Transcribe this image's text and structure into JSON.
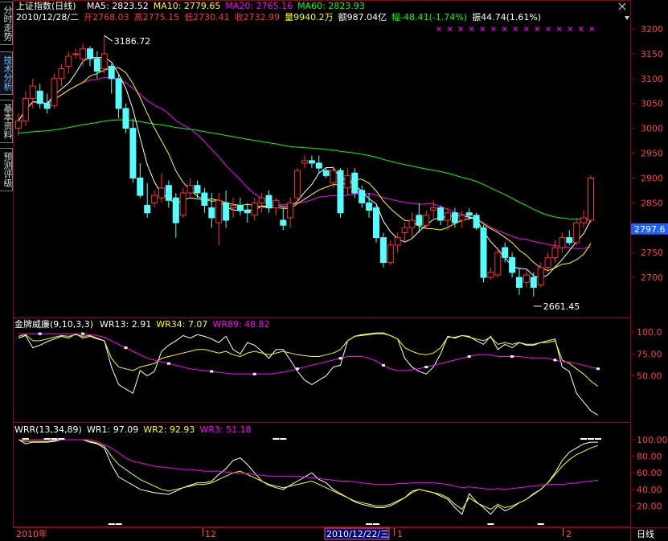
{
  "tabs": [
    {
      "label": "分时走势"
    },
    {
      "label": "技术分析"
    },
    {
      "label": "基本资料"
    },
    {
      "label": "预测评级"
    }
  ],
  "main_header": {
    "title": "上证指数(日线)",
    "ma": [
      {
        "label": "MA5: 2823.52",
        "color": "#ffffff"
      },
      {
        "label": "MA10: 2779.65",
        "color": "#ffff00"
      },
      {
        "label": "MA20: 2765.16",
        "color": "#ff00ff"
      },
      {
        "label": "MA60: 2823.93",
        "color": "#00ff00"
      }
    ]
  },
  "info_line": [
    {
      "text": "2010/12/28/二",
      "color": "#ffffff"
    },
    {
      "text": "开2768.03",
      "color": "#ff3333"
    },
    {
      "text": "高2775.15",
      "color": "#ff3333"
    },
    {
      "text": "低2730.41",
      "color": "#ff3333"
    },
    {
      "text": "收2732.99",
      "color": "#ff3333"
    },
    {
      "text": "量9940.2万",
      "color": "#ffff00"
    },
    {
      "text": "额987.04亿",
      "color": "#ffffff"
    },
    {
      "text": "幅-48.41(-1.74%)",
      "color": "#00ff00"
    },
    {
      "text": "振44.74(1.61%)",
      "color": "#ffffff"
    }
  ],
  "price_axis": {
    "ticks": [
      "3200",
      "3150",
      "3100",
      "3050",
      "3000",
      "2950",
      "2900",
      "2850",
      "2800",
      "2750",
      "2700"
    ],
    "current_label": "2797.6"
  },
  "annotations": {
    "high": "3186.72",
    "low": "2661.45"
  },
  "wr_panel": {
    "title": "金牌威廉(9,10,3,3)",
    "items": [
      {
        "label": "WR13: 2.91",
        "color": "#ffffff"
      },
      {
        "label": "WR34: 7.07",
        "color": "#ffff00"
      },
      {
        "label": "WR89: 48.82",
        "color": "#ff00ff"
      }
    ],
    "ticks": [
      "100.0",
      "75.00",
      "50.00"
    ]
  },
  "wrr_panel": {
    "title": "WRR(13,34,89)",
    "items": [
      {
        "label": "WR1: 97.09",
        "color": "#ffffff"
      },
      {
        "label": "WR2: 92.93",
        "color": "#ffff00"
      },
      {
        "label": "WR3: 51.18",
        "color": "#ff00ff"
      }
    ],
    "ticks": [
      "100.00",
      "80.00",
      "60.00",
      "40.00",
      "20.00"
    ]
  },
  "time_axis": {
    "labels": [
      "2010年",
      "12",
      "2010/12/22/三",
      "1",
      "2"
    ],
    "period": "日线"
  },
  "colors": {
    "up": "#ff3030",
    "down": "#54ffff",
    "ma5": "#ffffff",
    "ma10": "#ffff00",
    "ma20": "#ff00ff",
    "ma60": "#00ff00",
    "frame": "#a00000"
  },
  "chart_data": {
    "type": "candlestick",
    "candles": [
      [
        3000,
        3030,
        2985,
        3015
      ],
      [
        3015,
        3075,
        3005,
        3060
      ],
      [
        3060,
        3100,
        3040,
        3085
      ],
      [
        3075,
        3090,
        3040,
        3050
      ],
      [
        3050,
        3070,
        3030,
        3040
      ],
      [
        3045,
        3110,
        3040,
        3100
      ],
      [
        3100,
        3130,
        3085,
        3120
      ],
      [
        3125,
        3155,
        3110,
        3145
      ],
      [
        3150,
        3160,
        3140,
        3150
      ],
      [
        3140,
        3170,
        3125,
        3160
      ],
      [
        3160,
        3165,
        3125,
        3140
      ],
      [
        3140,
        3155,
        3100,
        3115
      ],
      [
        3120,
        3186.72,
        3110,
        3150
      ],
      [
        3125,
        3130,
        3070,
        3100
      ],
      [
        3100,
        3110,
        3020,
        3040
      ],
      [
        3040,
        3050,
        2990,
        3000
      ],
      [
        3000,
        3020,
        2890,
        2900
      ],
      [
        2900,
        2930,
        2860,
        2865
      ],
      [
        2845,
        2890,
        2820,
        2830
      ],
      [
        2850,
        2875,
        2840,
        2865
      ],
      [
        2860,
        2910,
        2850,
        2880
      ],
      [
        2885,
        2895,
        2840,
        2855
      ],
      [
        2860,
        2870,
        2780,
        2810
      ],
      [
        2825,
        2880,
        2820,
        2870
      ],
      [
        2870,
        2900,
        2860,
        2885
      ],
      [
        2885,
        2895,
        2860,
        2870
      ],
      [
        2870,
        2880,
        2830,
        2845
      ],
      [
        2840,
        2870,
        2800,
        2820
      ],
      [
        2810,
        2870,
        2765,
        2855
      ],
      [
        2850,
        2875,
        2800,
        2815
      ],
      [
        2840,
        2860,
        2820,
        2845
      ],
      [
        2845,
        2860,
        2825,
        2835
      ],
      [
        2835,
        2850,
        2810,
        2830
      ],
      [
        2825,
        2860,
        2815,
        2850
      ],
      [
        2850,
        2870,
        2830,
        2860
      ],
      [
        2865,
        2875,
        2830,
        2840
      ],
      [
        2840,
        2860,
        2825,
        2855
      ],
      [
        2815,
        2840,
        2795,
        2805
      ],
      [
        2820,
        2860,
        2800,
        2850
      ],
      [
        2860,
        2920,
        2850,
        2915
      ],
      [
        2930,
        2945,
        2920,
        2935
      ],
      [
        2935,
        2945,
        2920,
        2930
      ],
      [
        2930,
        2945,
        2910,
        2920
      ],
      [
        2915,
        2920,
        2900,
        2905
      ],
      [
        2890,
        2925,
        2880,
        2915
      ],
      [
        2915,
        2920,
        2820,
        2830
      ],
      [
        2880,
        2920,
        2865,
        2905
      ],
      [
        2910,
        2920,
        2860,
        2870
      ],
      [
        2875,
        2885,
        2840,
        2850
      ],
      [
        2850,
        2870,
        2820,
        2835
      ],
      [
        2840,
        2845,
        2770,
        2780
      ],
      [
        2780,
        2790,
        2720,
        2730
      ],
      [
        2730,
        2775.15,
        2725,
        2765
      ],
      [
        2765,
        2790,
        2750,
        2780
      ],
      [
        2790,
        2810,
        2770,
        2800
      ],
      [
        2800,
        2830,
        2780,
        2815
      ],
      [
        2825,
        2850,
        2790,
        2805
      ],
      [
        2805,
        2835,
        2800,
        2825
      ],
      [
        2835,
        2855,
        2820,
        2840
      ],
      [
        2840,
        2845,
        2805,
        2815
      ],
      [
        2815,
        2840,
        2795,
        2830
      ],
      [
        2830,
        2840,
        2800,
        2810
      ],
      [
        2815,
        2835,
        2800,
        2825
      ],
      [
        2830,
        2840,
        2815,
        2825
      ],
      [
        2825,
        2830,
        2795,
        2800
      ],
      [
        2800,
        2805,
        2690,
        2700
      ],
      [
        2700,
        2720,
        2695,
        2710
      ],
      [
        2705,
        2760,
        2700,
        2750
      ],
      [
        2760,
        2770,
        2730,
        2740
      ],
      [
        2740,
        2750,
        2700,
        2710
      ],
      [
        2700,
        2720,
        2665,
        2680
      ],
      [
        2690,
        2715,
        2680,
        2705
      ],
      [
        2700,
        2710,
        2661.45,
        2680
      ],
      [
        2685,
        2730,
        2680,
        2720
      ],
      [
        2720,
        2750,
        2710,
        2740
      ],
      [
        2740,
        2775,
        2730,
        2760
      ],
      [
        2760,
        2790,
        2750,
        2780
      ],
      [
        2780,
        2795,
        2765,
        2770
      ],
      [
        2770,
        2820,
        2765,
        2810
      ],
      [
        2810,
        2835,
        2800,
        2820
      ],
      [
        2815,
        2905,
        2810,
        2900
      ]
    ],
    "wr_panel": {
      "wr13": [
        93,
        96,
        82,
        85,
        89,
        92,
        95,
        93,
        98,
        93,
        95,
        92,
        90,
        60,
        40,
        35,
        30,
        56,
        50,
        55,
        78,
        85,
        90,
        96,
        93,
        97,
        95,
        92,
        88,
        95,
        80,
        75,
        88,
        85,
        78,
        70,
        80,
        80,
        68,
        55,
        45,
        40,
        45,
        50,
        60,
        62,
        90,
        95,
        97,
        98,
        99,
        99,
        96,
        92,
        70,
        60,
        55,
        52,
        60,
        75,
        95,
        93,
        96,
        95,
        90,
        86,
        95,
        80,
        86,
        82,
        88,
        85,
        85,
        88,
        90,
        92,
        60,
        55,
        30,
        20,
        10,
        5
      ],
      "wr34": [
        95,
        97,
        90,
        90,
        92,
        94,
        96,
        95,
        97,
        95,
        96,
        93,
        90,
        70,
        60,
        58,
        56,
        60,
        62,
        64,
        70,
        72,
        74,
        76,
        78,
        80,
        80,
        78,
        76,
        78,
        74,
        72,
        76,
        78,
        76,
        74,
        76,
        78,
        76,
        74,
        73,
        72,
        72,
        74,
        76,
        80,
        90,
        95,
        96,
        97,
        98,
        98,
        96,
        92,
        82,
        78,
        75,
        74,
        76,
        82,
        94,
        94,
        96,
        94,
        92,
        90,
        94,
        86,
        88,
        86,
        88,
        86,
        86,
        88,
        88,
        90,
        68,
        64,
        58,
        52,
        44,
        38
      ],
      "wr89": [
        98,
        98,
        98,
        98,
        98,
        98,
        98,
        98,
        98,
        98,
        97,
        96,
        94,
        90,
        86,
        82,
        78,
        74,
        70,
        68,
        66,
        64,
        62,
        60,
        58,
        57,
        56,
        55,
        54,
        53,
        52,
        52,
        52,
        52,
        52,
        52,
        53,
        54,
        56,
        58,
        60,
        62,
        64,
        66,
        68,
        70,
        72,
        72,
        72,
        70,
        67,
        62,
        58,
        56,
        56,
        57,
        58,
        60,
        62,
        64,
        66,
        68,
        70,
        72,
        74,
        74,
        74,
        72,
        72,
        72,
        72,
        71,
        70,
        70,
        70,
        68,
        66,
        66,
        64,
        62,
        60,
        58
      ]
    },
    "wrr_panel": {
      "wr1": [
        100,
        95,
        97,
        97,
        97,
        98,
        100,
        100,
        100,
        100,
        97,
        95,
        90,
        70,
        55,
        50,
        45,
        40,
        38,
        36,
        35,
        34,
        38,
        42,
        45,
        48,
        48,
        50,
        58,
        65,
        75,
        78,
        70,
        60,
        50,
        45,
        42,
        40,
        45,
        50,
        55,
        60,
        52,
        48,
        40,
        35,
        30,
        25,
        22,
        20,
        18,
        18,
        20,
        25,
        30,
        38,
        40,
        38,
        36,
        32,
        28,
        18,
        10,
        35,
        25,
        18,
        10,
        20,
        14,
        18,
        24,
        28,
        35,
        40,
        48,
        60,
        75,
        85,
        90,
        95,
        97,
        97
      ],
      "wr2": [
        100,
        98,
        98,
        98,
        98,
        99,
        100,
        100,
        100,
        100,
        98,
        96,
        92,
        80,
        70,
        64,
        58,
        52,
        48,
        44,
        40,
        38,
        40,
        42,
        44,
        46,
        46,
        48,
        52,
        56,
        60,
        62,
        58,
        54,
        50,
        46,
        44,
        42,
        44,
        46,
        48,
        50,
        46,
        42,
        38,
        34,
        30,
        26,
        24,
        22,
        20,
        20,
        22,
        26,
        30,
        36,
        40,
        38,
        36,
        34,
        30,
        22,
        16,
        30,
        24,
        20,
        16,
        22,
        18,
        20,
        24,
        28,
        34,
        40,
        48,
        58,
        68,
        76,
        82,
        86,
        90,
        93
      ],
      "wr3": [
        100,
        100,
        100,
        100,
        100,
        100,
        100,
        100,
        100,
        100,
        100,
        98,
        94,
        90,
        84,
        78,
        74,
        72,
        70,
        68,
        67,
        66,
        65,
        64,
        64,
        63,
        62,
        62,
        62,
        61,
        60,
        60,
        59,
        58,
        57,
        56,
        56,
        56,
        56,
        56,
        55,
        54,
        53,
        52,
        51,
        50,
        50,
        49,
        48,
        47,
        46,
        46,
        46,
        47,
        47,
        48,
        48,
        48,
        48,
        47,
        46,
        44,
        42,
        43,
        42,
        41,
        40,
        41,
        40,
        41,
        42,
        43,
        44,
        45,
        46,
        46,
        46,
        47,
        48,
        49,
        50,
        51
      ]
    }
  }
}
